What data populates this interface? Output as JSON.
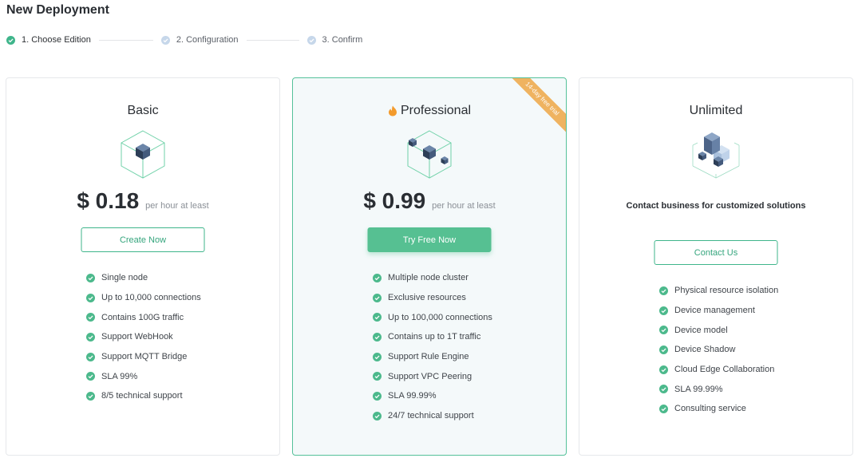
{
  "page": {
    "title": "New Deployment"
  },
  "steps": [
    {
      "label": "1. Choose Edition",
      "state": "done",
      "color": "#3fb58b"
    },
    {
      "label": "2. Configuration",
      "state": "pending",
      "color": "#bcd0e6"
    },
    {
      "label": "3. Confirm",
      "state": "pending",
      "color": "#bcd0e6"
    }
  ],
  "plans": {
    "basic": {
      "title": "Basic",
      "price": "$ 0.18",
      "price_note": "per hour at least",
      "button_label": "Create Now",
      "icon": "single-cube-icon",
      "features": [
        "Single node",
        "Up to 10,000 connections",
        "Contains 100G traffic",
        "Support WebHook",
        "Support MQTT Bridge",
        "SLA 99%",
        "8/5 technical support"
      ]
    },
    "professional": {
      "title": "Professional",
      "ribbon": "14-day free trial",
      "price": "$ 0.99",
      "price_note": "per hour at least",
      "button_label": "Try Free Now",
      "icon": "multi-cube-icon",
      "features": [
        "Multiple node cluster",
        "Exclusive resources",
        "Up to 100,000 connections",
        "Contains up to 1T traffic",
        "Support Rule Engine",
        "Support VPC Peering",
        "SLA 99.99%",
        "24/7 technical support"
      ]
    },
    "unlimited": {
      "title": "Unlimited",
      "note": "Contact business for customized solutions",
      "button_label": "Contact Us",
      "icon": "cube-stack-icon",
      "features": [
        "Physical resource isolation",
        "Device management",
        "Device model",
        "Device Shadow",
        "Cloud Edge Collaboration",
        "SLA 99.99%",
        "Consulting service"
      ]
    }
  },
  "colors": {
    "accent": "#3fb58b",
    "ribbon": "#efb360",
    "check": "#4cb98c"
  }
}
